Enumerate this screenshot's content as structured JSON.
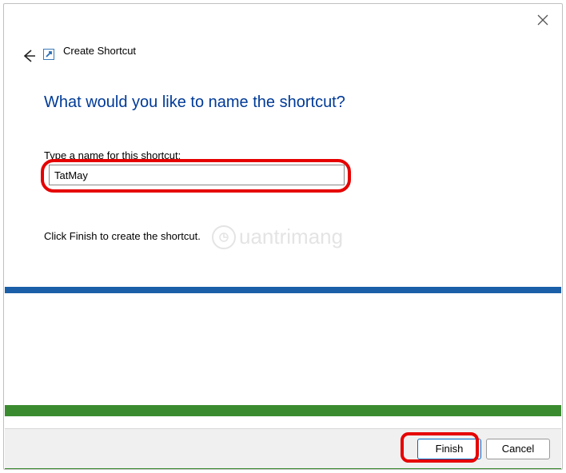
{
  "header": {
    "title": "Create Shortcut"
  },
  "main": {
    "heading": "What would you like to name the shortcut?",
    "label": "Type a name for this shortcut:",
    "name_value": "TatMay",
    "instruction": "Click Finish to create the shortcut."
  },
  "footer": {
    "finish": "Finish",
    "cancel": "Cancel"
  },
  "watermark": {
    "text": "uantrimang"
  }
}
